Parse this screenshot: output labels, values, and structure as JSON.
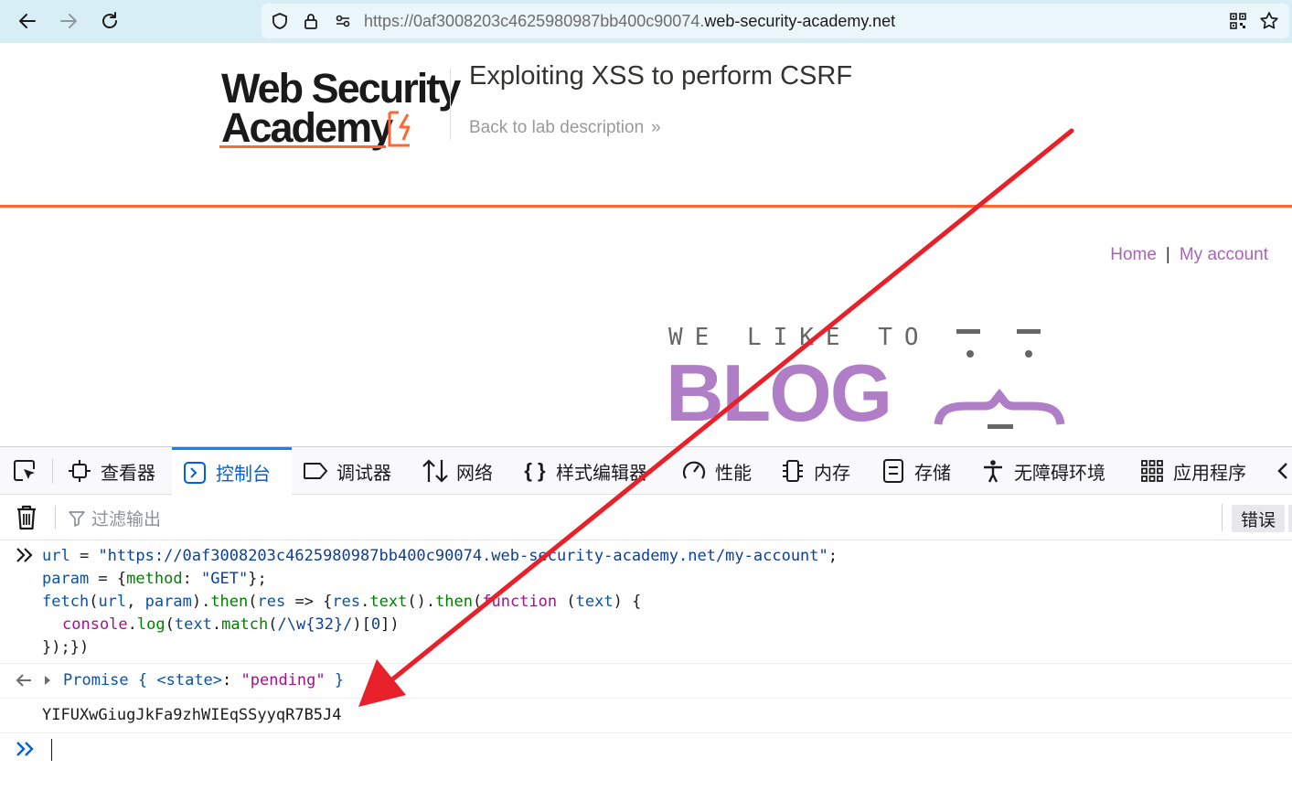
{
  "browser": {
    "url_dim": "https://0af3008203c4625980987bb400c90074.",
    "url_domain": "web-security-academy.net"
  },
  "lab": {
    "logo_line1": "Web Security",
    "logo_line2": "Academy",
    "title": "Exploiting XSS to perform CSRF",
    "back_link": "Back to lab description"
  },
  "nav": {
    "home": "Home",
    "separator": "|",
    "my_account": "My account"
  },
  "banner": {
    "top_text": "WE LIKE TO",
    "big_text": "BLOG"
  },
  "devtools": {
    "tabs": [
      {
        "label": "查看器",
        "icon": "inspector-icon"
      },
      {
        "label": "控制台",
        "icon": "console-icon"
      },
      {
        "label": "调试器",
        "icon": "debugger-icon"
      },
      {
        "label": "网络",
        "icon": "network-icon"
      },
      {
        "label": "样式编辑器",
        "icon": "style-editor-icon"
      },
      {
        "label": "性能",
        "icon": "performance-icon"
      },
      {
        "label": "内存",
        "icon": "memory-icon"
      },
      {
        "label": "存储",
        "icon": "storage-icon"
      },
      {
        "label": "无障碍环境",
        "icon": "accessibility-icon"
      },
      {
        "label": "应用程序",
        "icon": "application-icon"
      }
    ],
    "active_tab": "控制台",
    "filter_placeholder": "过滤输出",
    "errors_button": "错误"
  },
  "console": {
    "input_lines": {
      "l1_var": "url",
      "l1_eq": " = ",
      "l1_str": "\"https://0af3008203c4625980987bb400c90074.web-security-academy.net/my-account\"",
      "l1_end": ";",
      "l2_var": "param",
      "l2_a": " = {",
      "l2_key": "method",
      "l2_b": ": ",
      "l2_str": "\"GET\"",
      "l2_end": "};",
      "l3_fn": "fetch",
      "l3_a": "(",
      "l3_url": "url",
      "l3_b": ", ",
      "l3_param": "param",
      "l3_c": ").",
      "l3_then": "then",
      "l3_d": "(",
      "l3_res": "res",
      "l3_e": " => {",
      "l3_res2": "res",
      "l3_f": ".",
      "l3_text": "text",
      "l3_g": "().",
      "l3_then2": "then",
      "l3_h": "(",
      "l3_function": "function",
      "l3_i": " (",
      "l3_textparam": "text",
      "l3_j": ") {",
      "l4_console": "console",
      "l4_a": ".",
      "l4_log": "log",
      "l4_b": "(",
      "l4_text": "text",
      "l4_c": ".",
      "l4_match": "match",
      "l4_d": "(",
      "l4_regex": "/\\w{32}/",
      "l4_e": ")[",
      "l4_zero": "0",
      "l4_f": "])",
      "l5": "});})"
    },
    "promise": {
      "word": "Promise",
      "open": " { ",
      "state_key": "<state>",
      "colon": ": ",
      "state_val": "\"pending\"",
      "close": " }"
    },
    "log_output": "YIFUXwGiugJkFa9zhWIEqSSyyqR7B5J4"
  },
  "colors": {
    "accent_orange": "#ff6633",
    "nav_link": "#a865b5",
    "banner_purple": "#b07ec7",
    "console_active": "#0060df",
    "annotation_red": "#e8202a"
  }
}
